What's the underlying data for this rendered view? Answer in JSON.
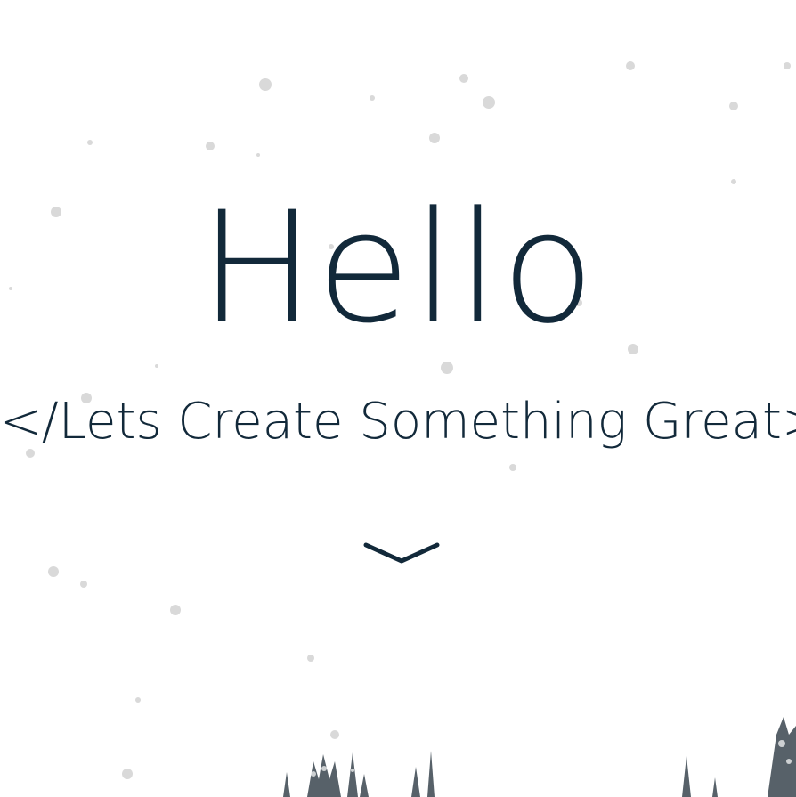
{
  "hero": {
    "headline": "Hello",
    "tagline": "</Lets Create Something Great>",
    "scroll_icon": "chevron-down-icon"
  },
  "colors": {
    "text": "#12293a",
    "background": "#ffffff",
    "snow": "#d9d9d9",
    "trees": "#3a4650"
  }
}
